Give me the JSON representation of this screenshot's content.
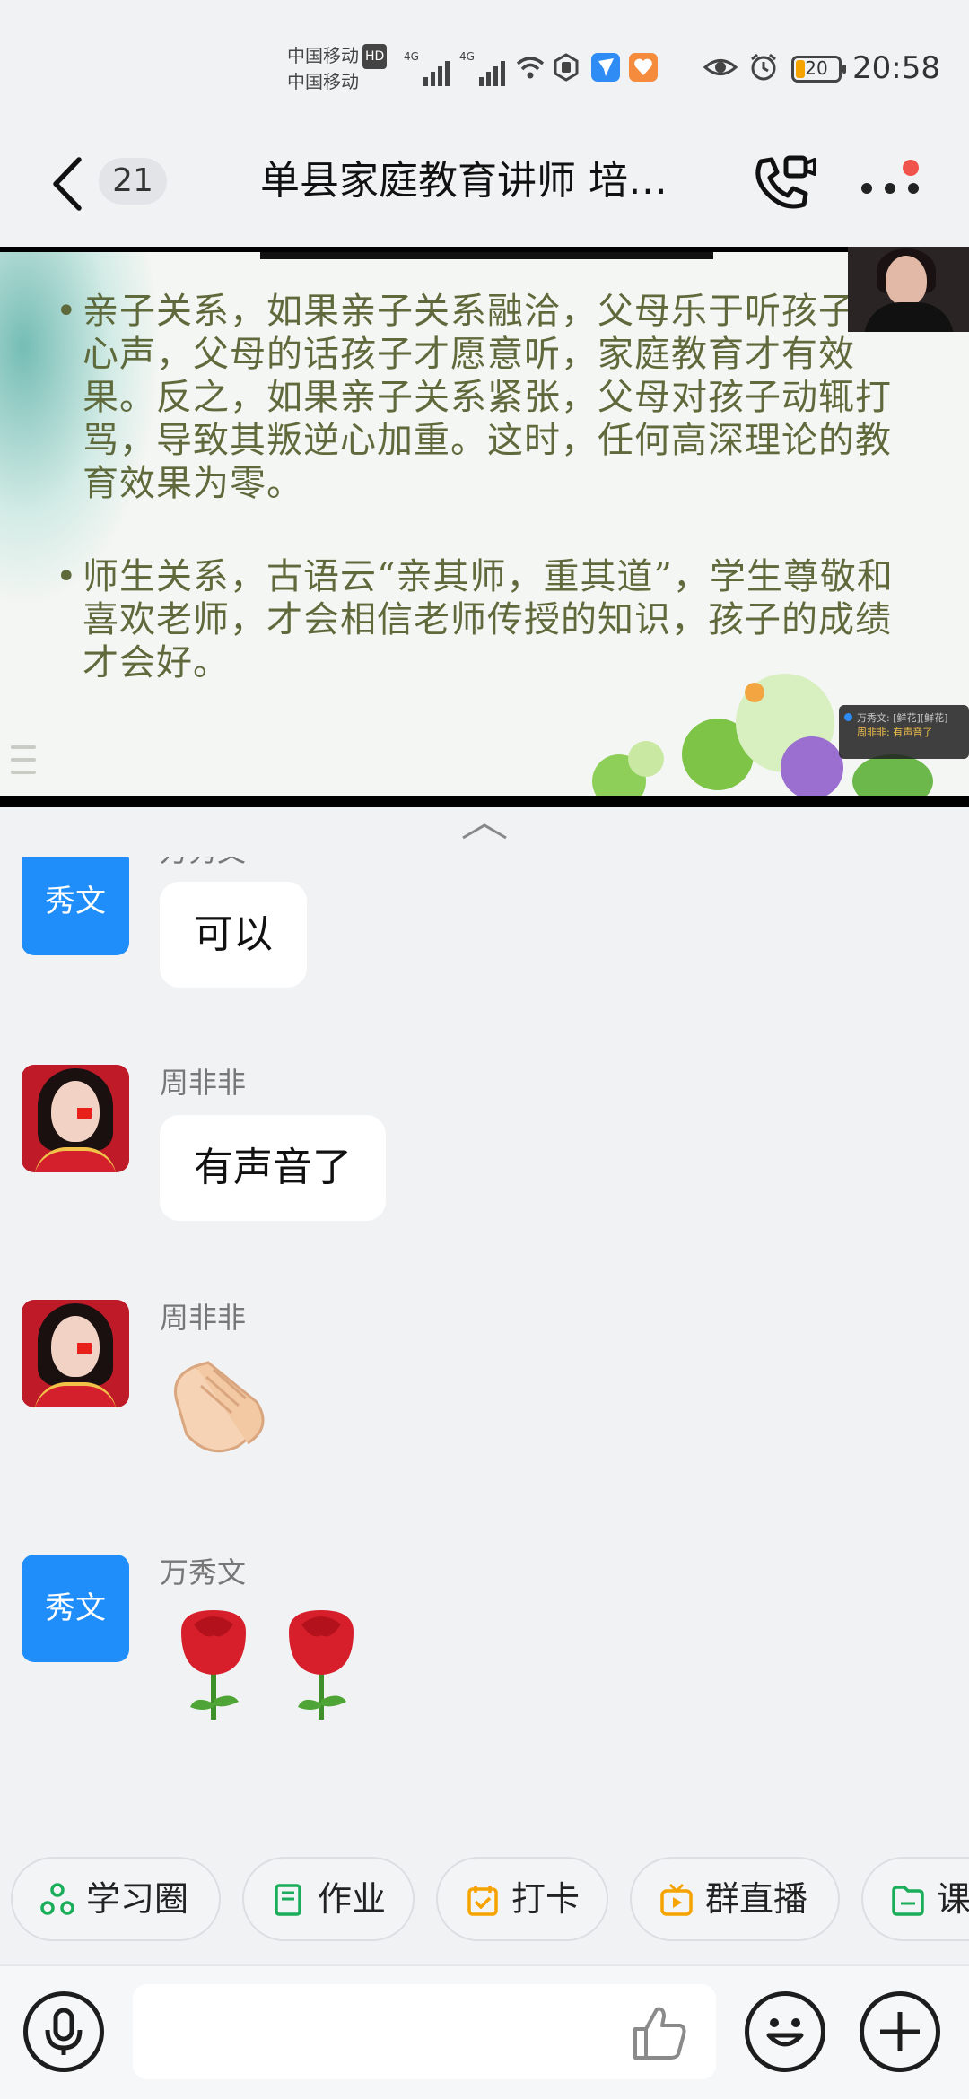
{
  "status_bar": {
    "carrier_1": "中国移动",
    "carrier_1_badge": "HD",
    "carrier_2": "中国移动",
    "sig_1_label": "4G",
    "sig_2_label": "4G",
    "battery_level": "20",
    "time": "20:58",
    "icons": [
      "signal-icon",
      "signal-icon",
      "wifi-icon",
      "hexagon-icon",
      "navigation-icon",
      "health-app-icon",
      "eye-icon",
      "alarm-icon",
      "battery-icon"
    ]
  },
  "header": {
    "unread_count": "21",
    "title": "单县家庭教育讲师 培…",
    "icons": [
      "back-chevron-icon",
      "video-call-icon",
      "more-icon"
    ]
  },
  "live_slide": {
    "bullet_1": "亲子关系，如果亲子关系融洽，父母乐于听孩子的心声，父母的话孩子才愿意听，家庭教育才有效果。反之，如果亲子关系紧张，父母对孩子动辄打骂，导致其叛逆心加重。这时，任何高深理论的教育效果为零。",
    "bullet_2": "师生关系，古语云“亲其师，重其道”，学生尊敬和喜欢老师，才会相信老师传授的知识，孩子的成绩才会好。",
    "danmu_line_1": "万秀文: [鲜花][鲜花]",
    "danmu_line_2": "周非非: 有声音了"
  },
  "messages": [
    {
      "sender": "万秀文",
      "avatar_text": "秀文",
      "type": "text",
      "content": "可以"
    },
    {
      "sender": "周非非",
      "type": "text",
      "content": "有声音了"
    },
    {
      "sender": "周非非",
      "type": "emoji",
      "content": "👏"
    },
    {
      "sender": "万秀文",
      "avatar_text": "秀文",
      "type": "emoji",
      "content": "🌹 🌹"
    }
  ],
  "quick_apps": [
    {
      "label": "学习圈",
      "color": "#1aad5a"
    },
    {
      "label": "作业",
      "color": "#1aad5a"
    },
    {
      "label": "打卡",
      "color": "#f5a300"
    },
    {
      "label": "群直播",
      "color": "#f5a300"
    },
    {
      "label": "课",
      "color": "#1aad5a"
    }
  ],
  "input_bar": {
    "placeholder": "",
    "icons": [
      "microphone-icon",
      "thumbs-up-icon",
      "emoji-icon",
      "plus-icon"
    ]
  },
  "colors": {
    "accent_blue": "#1f8efa",
    "background": "#f1f2f4",
    "slide_text": "#5e6a3b",
    "badge_red": "#f0524c"
  }
}
